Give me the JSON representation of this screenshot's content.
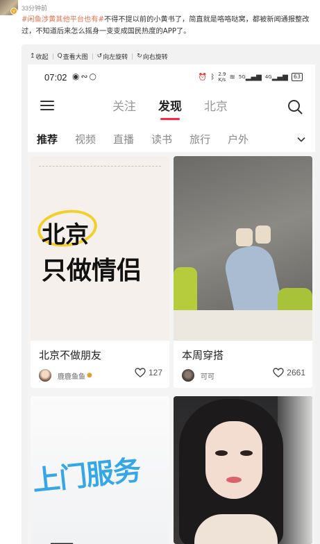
{
  "post": {
    "time": "33分钟前",
    "topic1": "#闲鱼涉黄其他平台也有#",
    "body": "不得不提以前的小黄书了，简直就是咯咯哒窝，都被新闻通报整改过，不知道后来怎么摇身一变变成国民热度的APP了。",
    "avatar_badge": "v"
  },
  "toolbar": {
    "items": [
      {
        "icon": "collapse-icon",
        "label": "收起"
      },
      {
        "icon": "search-icon",
        "label": "查看大图"
      },
      {
        "icon": "rotate-left-icon",
        "label": "向左旋转"
      },
      {
        "icon": "rotate-right-icon",
        "label": "向右旋转"
      }
    ]
  },
  "phone": {
    "status": {
      "time": "07:02",
      "net_speed_top": "2.9",
      "net_speed_unit": "K/s",
      "signal1": "5G",
      "signal2": "4G",
      "battery": "63"
    },
    "nav": {
      "tabs": [
        "关注",
        "发现",
        "北京"
      ],
      "active_tab": "发现"
    },
    "categories": {
      "items": [
        "推荐",
        "视频",
        "直播",
        "读书",
        "旅行",
        "户外"
      ],
      "active": "推荐"
    },
    "notes": [
      {
        "cover_line1": "北京",
        "cover_line2": "只做情侣",
        "title": "北京不做朋友",
        "author": "鹿鹿鱼鱼",
        "likes": "127"
      },
      {
        "title": "本周穿搭",
        "author": "可可",
        "likes": "2661"
      },
      {
        "cover_line1": "上门服务",
        "cover_line2": "一…"
      },
      {}
    ]
  },
  "colors": {
    "accent_red": "#ff2442",
    "topic_orange": "#eb7350"
  }
}
